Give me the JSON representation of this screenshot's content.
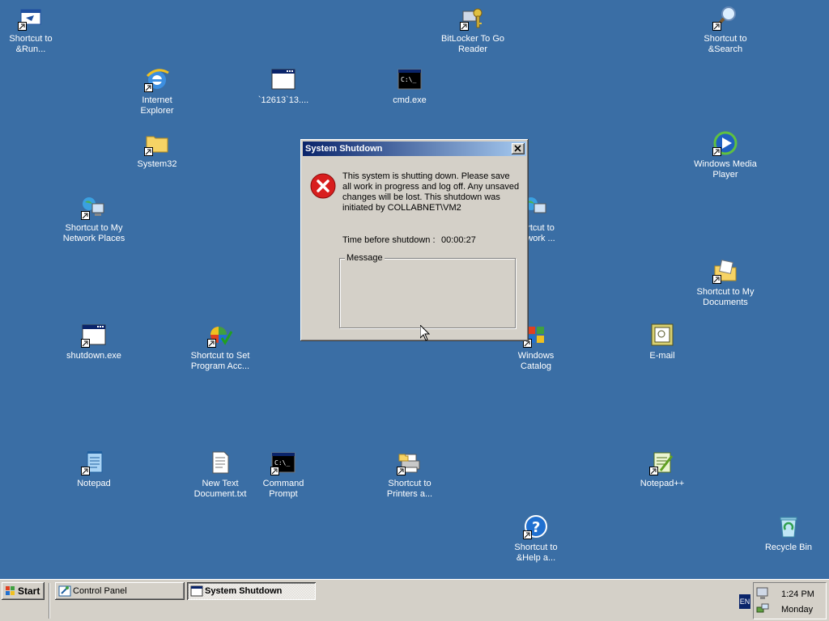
{
  "desktop": {
    "background": "#3a6ea5",
    "icons": [
      {
        "label": "Shortcut to\n&Run...",
        "icon": "run-window-icon"
      },
      {
        "label": "BitLocker To Go\nReader",
        "icon": "bitlocker-keys-icon"
      },
      {
        "label": "Shortcut to\n&Search",
        "icon": "search-magnifier-icon"
      },
      {
        "label": "Internet\nExplorer",
        "icon": "internet-explorer-icon"
      },
      {
        "label": "`12613`13....",
        "icon": "application-window-icon"
      },
      {
        "label": "cmd.exe",
        "icon": "command-prompt-icon"
      },
      {
        "label": "System32",
        "icon": "folder-icon"
      },
      {
        "label": "Windows Media\nPlayer",
        "icon": "media-player-icon"
      },
      {
        "label": "Shortcut to My\nNetwork Places",
        "icon": "network-places-icon"
      },
      {
        "label": "rtcut to\nwork ...",
        "icon": "network-places-icon"
      },
      {
        "label": "Shortcut to My\nDocuments",
        "icon": "my-documents-icon"
      },
      {
        "label": "shutdown.exe",
        "icon": "application-window-icon"
      },
      {
        "label": "Shortcut to Set\nProgram Acc...",
        "icon": "program-access-icon"
      },
      {
        "label": "Windows\nCatalog",
        "icon": "windows-catalog-icon"
      },
      {
        "label": "E-mail",
        "icon": "email-icon"
      },
      {
        "label": "Notepad",
        "icon": "notepad-icon"
      },
      {
        "label": "New Text\nDocument.txt",
        "icon": "text-document-icon"
      },
      {
        "label": "Command\nPrompt",
        "icon": "command-prompt-icon"
      },
      {
        "label": "Shortcut to\nPrinters a...",
        "icon": "printer-icon"
      },
      {
        "label": "Notepad++",
        "icon": "notepadpp-icon"
      },
      {
        "label": "Shortcut to\n&Help a...",
        "icon": "help-icon"
      },
      {
        "label": "Recycle Bin",
        "icon": "recycle-bin-icon"
      }
    ]
  },
  "dialog": {
    "title": "System Shutdown",
    "message": "This system is shutting down. Please save all work in progress and log off. Any unsaved changes will be lost. This shutdown was initiated by COLLABNET\\VM2",
    "time_label": "Time before shutdown :",
    "time_value": "00:00:27",
    "message_group_label": "Message",
    "message_group_value": ""
  },
  "taskbar": {
    "start_label": "Start",
    "tasks": [
      {
        "label": "Control Panel",
        "active": false
      },
      {
        "label": "System Shutdown",
        "active": true
      }
    ],
    "language": "EN",
    "clock_time": "1:24 PM",
    "clock_day": "Monday"
  }
}
